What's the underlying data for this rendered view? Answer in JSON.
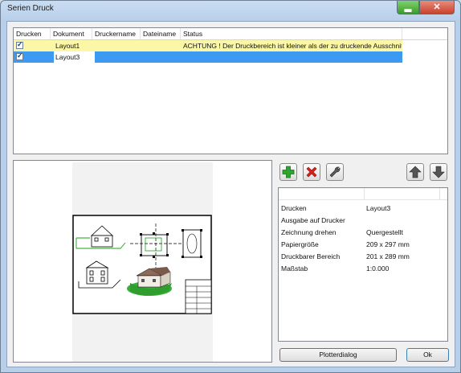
{
  "window": {
    "title": "Serien Druck",
    "minimize_glyph": "▂",
    "close_glyph": "✕"
  },
  "table": {
    "columns": [
      "Drucken",
      "Dokument",
      "Druckername",
      "Dateiname",
      "Status"
    ],
    "rows": [
      {
        "drucken": true,
        "dokument": "Layout1",
        "druckername": "",
        "dateiname": "",
        "status": "ACHTUNG ! Der Druckbereich ist kleiner als der zu druckende Ausschnitt ..."
      },
      {
        "drucken": true,
        "dokument": "Layout3",
        "druckername": "",
        "dateiname": "",
        "status": ""
      }
    ]
  },
  "toolbar": {
    "add_icon": "plus-icon",
    "delete_icon": "x-icon",
    "settings_icon": "wrench-icon",
    "up_icon": "arrow-up-icon",
    "down_icon": "arrow-down-icon"
  },
  "properties": [
    {
      "key": "Drucken",
      "value": "Layout3"
    },
    {
      "key": "Ausgabe auf Drucker",
      "value": ""
    },
    {
      "key": "Zeichnung drehen",
      "value": "Quergestellt"
    },
    {
      "key": "Papiergröße",
      "value": "209 x 297 mm"
    },
    {
      "key": "Druckbarer Bereich",
      "value": "201 x 289 mm"
    },
    {
      "key": "Maßstab",
      "value": "1:0.000"
    }
  ],
  "buttons": {
    "plotterdialog": "Plotterdialog",
    "ok": "Ok"
  },
  "colors": {
    "warning_row": "#fbf7a6",
    "selected_row": "#3d9af2",
    "add_green": "#2fa52f",
    "delete_red": "#d8201b"
  }
}
